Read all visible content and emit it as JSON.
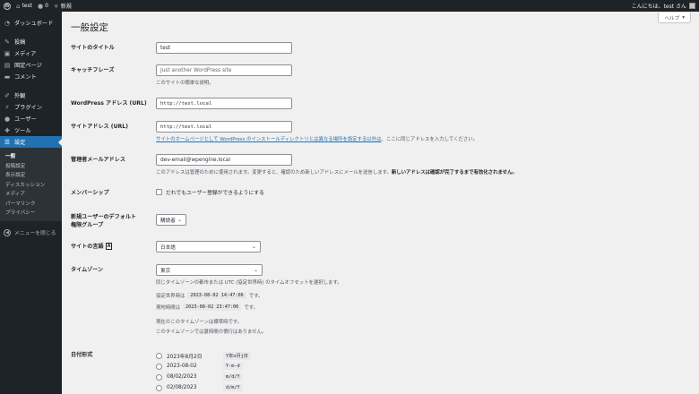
{
  "adminbar": {
    "site_name": "test",
    "comments_count": "0",
    "new_label": "新規",
    "greeting": "こんにちは、test さん"
  },
  "sidebar": {
    "items": [
      {
        "label": "ダッシュボード",
        "icon": "dashboard-icon"
      },
      {
        "label": "投稿",
        "icon": "pin-icon"
      },
      {
        "label": "メディア",
        "icon": "media-icon"
      },
      {
        "label": "固定ページ",
        "icon": "page-icon"
      },
      {
        "label": "コメント",
        "icon": "comment-icon"
      },
      {
        "label": "外観",
        "icon": "brush-icon"
      },
      {
        "label": "プラグイン",
        "icon": "plugin-icon"
      },
      {
        "label": "ユーザー",
        "icon": "user-icon"
      },
      {
        "label": "ツール",
        "icon": "wrench-icon"
      },
      {
        "label": "設定",
        "icon": "settings-icon"
      }
    ],
    "submenu": [
      "一般",
      "投稿設定",
      "表示設定",
      "ディスカッション",
      "メディア",
      "パーマリンク",
      "プライバシー"
    ],
    "collapse_label": "メニューを閉じる"
  },
  "help_label": "ヘルプ",
  "page_title": "一般設定",
  "fields": {
    "site_title": {
      "label": "サイトのタイトル",
      "value": "test"
    },
    "tagline": {
      "label": "キャッチフレーズ",
      "placeholder": "Just another WordPress site",
      "desc": "このサイトの簡単な説明。"
    },
    "wp_address": {
      "label": "WordPress アドレス (URL)",
      "value": "http://test.local"
    },
    "site_address": {
      "label": "サイトアドレス (URL)",
      "value": "http://test.local",
      "desc_link": "サイトのホームページとして WordPress のインストールディレクトリとは異なる場所を設定する以外は",
      "desc_rest": "、ここに同じアドレスを入力してください。"
    },
    "admin_email": {
      "label": "管理者メールアドレス",
      "value": "dev-email@wpengine.local",
      "desc_plain": "このアドレスは管理のために使用されます。変更すると、確認のため新しいアドレスにメールを送信します。",
      "desc_bold": "新しいアドレスは確認が完了するまで有効化されません。"
    },
    "membership": {
      "label": "メンバーシップ",
      "checkbox_label": "だれでもユーザー登録ができるようにする"
    },
    "default_role": {
      "label": "新規ユーザーのデフォルト権限グループ",
      "value": "購読者"
    },
    "site_language": {
      "label": "サイトの言語",
      "value": "日本語"
    },
    "timezone": {
      "label": "タイムゾーン",
      "value": "東京",
      "desc": "同じタイムゾーンの都市または UTC (協定世界時) のタイムオフセットを選択します。",
      "utc_label": "協定世界時は",
      "utc_time": "2023-08-02 14:47:06",
      "utc_suffix": "です。",
      "local_label": "現地時間は",
      "local_time": "2023-08-02 23:47:06",
      "local_suffix": "です。",
      "std_note": "現在のこのタイムゾーンは標準時です。",
      "dst_note": "このタイムゾーンでは夏時間の慣行はありません。"
    },
    "date_format": {
      "label": "日付形式",
      "options": [
        {
          "label": "2023年8月2日",
          "format": "Y年n月j日"
        },
        {
          "label": "2023-08-02",
          "format": "Y-m-d"
        },
        {
          "label": "08/02/2023",
          "format": "m/d/Y"
        },
        {
          "label": "02/08/2023",
          "format": "d/m/Y"
        }
      ]
    }
  }
}
